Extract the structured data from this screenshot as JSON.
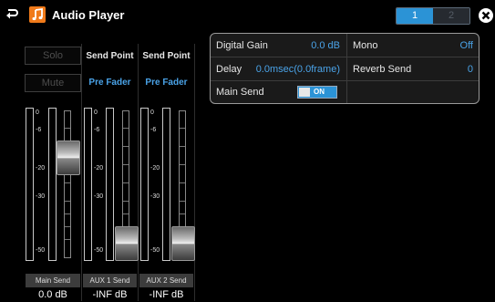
{
  "header": {
    "title": "Audio Player",
    "pages": [
      "1",
      "2"
    ],
    "active_page": "1"
  },
  "buttons": {
    "solo": "Solo",
    "mute": "Mute"
  },
  "channels": [
    {
      "name": "Main Send",
      "level": "0.0 dB",
      "fader": 0.72,
      "header": "",
      "mode": ""
    },
    {
      "name": "AUX 1 Send",
      "level": "-INF dB",
      "fader": 0.0,
      "header": "Send Point",
      "mode": "Pre Fader"
    },
    {
      "name": "AUX 2 Send",
      "level": "-INF dB",
      "fader": 0.0,
      "header": "Send Point",
      "mode": "Pre Fader"
    }
  ],
  "scale": [
    "0",
    "-6",
    "-20",
    "-30",
    "-50"
  ],
  "settings": {
    "digital_gain_label": "Digital Gain",
    "digital_gain_value": "0.0 dB",
    "mono_label": "Mono",
    "mono_value": "Off",
    "delay_label": "Delay",
    "delay_value": "0.0msec(0.0frame)",
    "reverb_send_label": "Reverb Send",
    "reverb_send_value": "0",
    "main_send_label": "Main Send",
    "main_send_toggle": "ON"
  },
  "colors": {
    "accent": "#2b93d6",
    "value_text": "#4aa3e8",
    "app_icon": "#f07a1a"
  },
  "icons": {
    "back": "return-arrow-icon",
    "app": "music-note-icon",
    "close": "close-circle-icon"
  }
}
